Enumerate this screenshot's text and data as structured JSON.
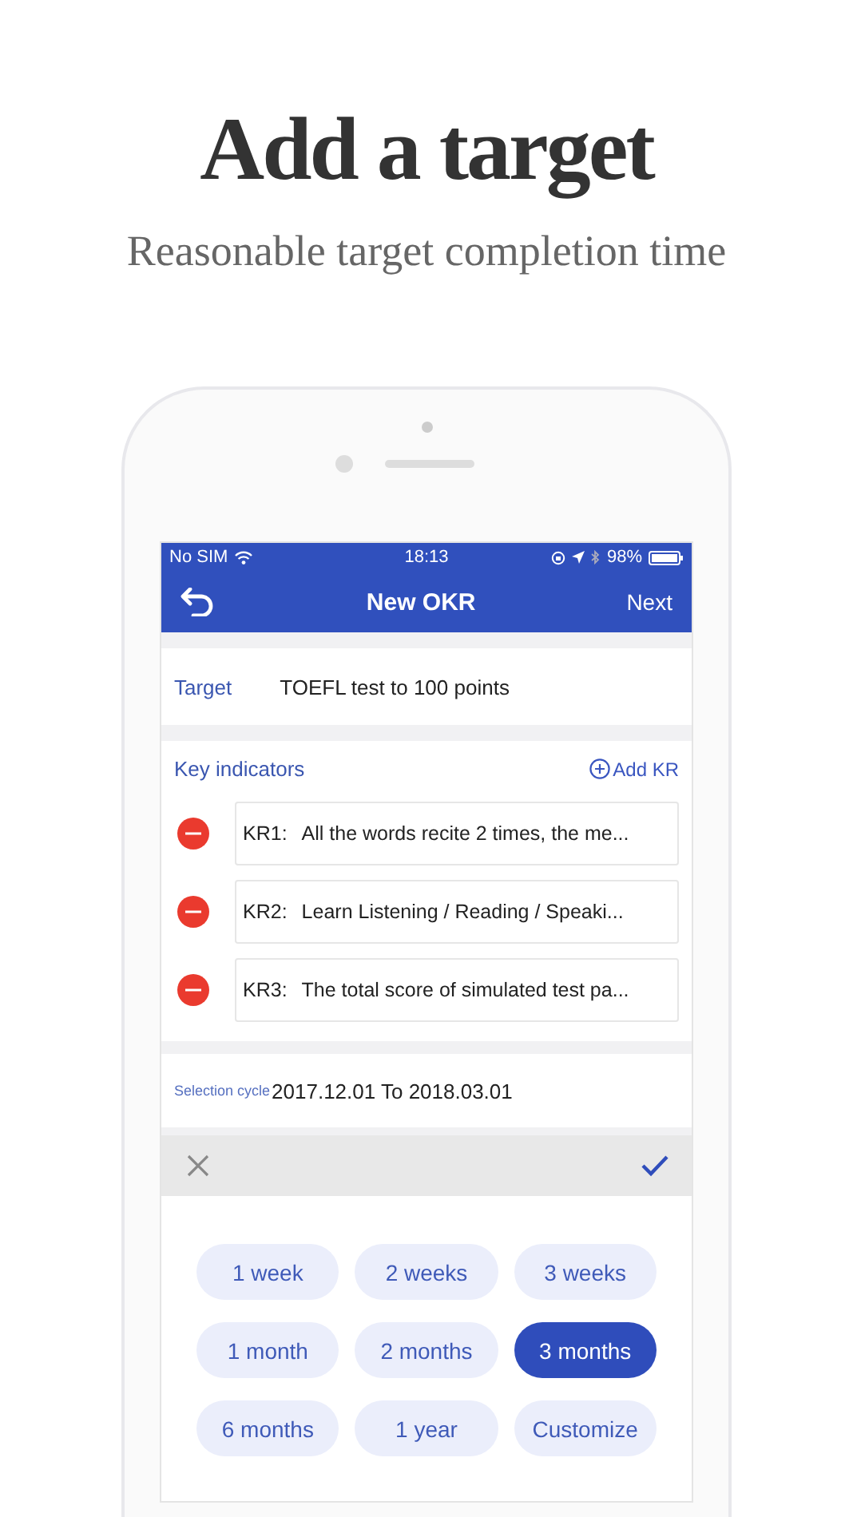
{
  "heading": "Add a target",
  "subheading": "Reasonable target completion time",
  "status_bar": {
    "carrier": "No SIM",
    "time": "18:13",
    "battery": "98%"
  },
  "nav": {
    "title": "New OKR",
    "action": "Next"
  },
  "target": {
    "label": "Target",
    "value": "TOEFL test to 100 points"
  },
  "key_indicators": {
    "label": "Key indicators",
    "add": "Add KR",
    "items": [
      {
        "code": "KR1:",
        "text": "All the words recite 2 times, the me..."
      },
      {
        "code": "KR2:",
        "text": "Learn Listening / Reading / Speaki..."
      },
      {
        "code": "KR3:",
        "text": "The total score of simulated test pa..."
      }
    ]
  },
  "cycle": {
    "label": "Selection cycle",
    "value": "2017.12.01 To 2018.03.01"
  },
  "options": [
    {
      "label": "1 week",
      "selected": false
    },
    {
      "label": "2 weeks",
      "selected": false
    },
    {
      "label": "3 weeks",
      "selected": false
    },
    {
      "label": "1 month",
      "selected": false
    },
    {
      "label": "2 months",
      "selected": false
    },
    {
      "label": "3 months",
      "selected": true
    },
    {
      "label": "6 months",
      "selected": false
    },
    {
      "label": "1 year",
      "selected": false
    },
    {
      "label": "Customize",
      "selected": false
    }
  ]
}
